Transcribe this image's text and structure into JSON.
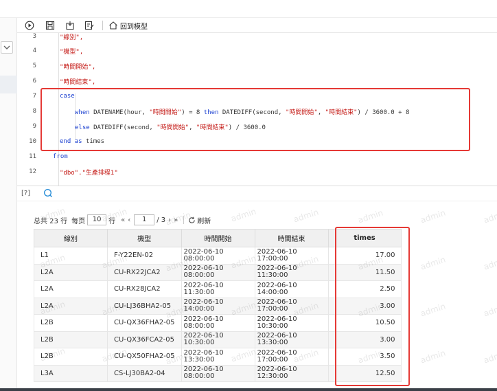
{
  "toolbar": {
    "back_to_model_label": "回到模型"
  },
  "editor": {
    "lines": [
      {
        "num": "3",
        "text": "\"線別\","
      },
      {
        "num": "4",
        "text": "\"機型\","
      },
      {
        "num": "5",
        "text": "\"時間開始\","
      },
      {
        "num": "6",
        "text": "\"時間結束\","
      },
      {
        "num": "7",
        "text": "case"
      },
      {
        "num": "8",
        "text": "when DATENAME(hour, \"時間開始\") = 8 then DATEDIFF(second, \"時間開始\", \"時間結束\") / 3600.0 + 8"
      },
      {
        "num": "9",
        "text": "else DATEDIFF(second, \"時間開始\", \"時間結束\") / 3600.0"
      },
      {
        "num": "10",
        "text": "end as times"
      },
      {
        "num": "11",
        "text": "from"
      },
      {
        "num": "12",
        "text": "\"dbo\".\"生產排程1\""
      }
    ]
  },
  "result": {
    "query_marker": "[?]",
    "pager": {
      "total": "总共 23 行",
      "per_page_label": "每页",
      "per_page": "10",
      "rows_unit": "行",
      "page": "1",
      "page_total": "/ 3",
      "refresh": "刷新"
    },
    "columns": [
      "線別",
      "機型",
      "時間開始",
      "時間結束",
      "times"
    ],
    "rows": [
      [
        "L1",
        "F-Y22EN-02",
        "2022-06-10 08:00:00",
        "2022-06-10 17:00:00",
        "17.00"
      ],
      [
        "L2A",
        "CU-RX22JCA2",
        "2022-06-10 08:00:00",
        "2022-06-10 11:30:00",
        "11.50"
      ],
      [
        "L2A",
        "CU-RX28JCA2",
        "2022-06-10 11:30:00",
        "2022-06-10 14:00:00",
        "2.50"
      ],
      [
        "L2A",
        "CU-LJ36BHA2-05",
        "2022-06-10 14:00:00",
        "2022-06-10 17:00:00",
        "3.00"
      ],
      [
        "L2B",
        "CU-QX36FHA2-05",
        "2022-06-10 08:00:00",
        "2022-06-10 10:30:00",
        "10.50"
      ],
      [
        "L2B",
        "CU-QX36FCA2-05",
        "2022-06-10 10:30:00",
        "2022-06-10 13:30:00",
        "3.00"
      ],
      [
        "L2B",
        "CU-QX50FHA2-05",
        "2022-06-10 13:30:00",
        "2022-06-10 17:00:00",
        "3.50"
      ],
      [
        "L3A",
        "CS-LJ30BA2-04",
        "2022-06-10 08:00:00",
        "2022-06-10 12:30:00",
        "12.50"
      ]
    ]
  },
  "watermark": "admin",
  "colors": {
    "highlight": "#e53935",
    "keyword": "#1a3fd0",
    "string": "#c41a16"
  }
}
